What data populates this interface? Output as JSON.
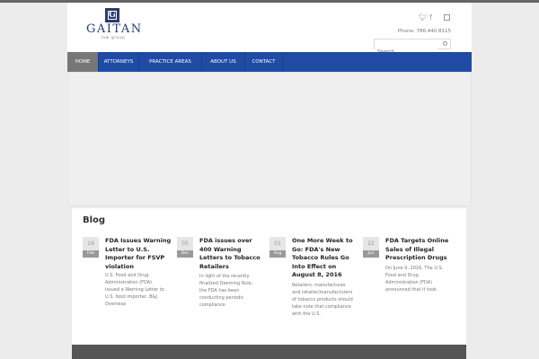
{
  "brand": {
    "name": "GAITAN",
    "tagline": "law group",
    "logo_letter": "G",
    "color": "#2a3a6e"
  },
  "header": {
    "phone": "Phone: 786.440.8115",
    "search_placeholder": "Search",
    "social": [
      "twitter-icon",
      "facebook-icon",
      "linkedin-icon"
    ]
  },
  "nav": {
    "accent": "#1f4ba5",
    "items": [
      {
        "label": "HOME",
        "active": true
      },
      {
        "label": "ATTORNEYS"
      },
      {
        "label": "PRACTICE AREAS"
      },
      {
        "label": "ABOUT US"
      },
      {
        "label": "CONTACT"
      }
    ]
  },
  "blog": {
    "title": "Blog",
    "posts": [
      {
        "day": "19",
        "month": "Feb",
        "title": "FDA Issues Warning Letter to U.S. Importer for FSVP violation",
        "excerpt": "U.S. Food and Drug Administration (FDA) issued a Warning Letter to U.S. food importer, B&J Overseas"
      },
      {
        "day": "05",
        "month": "Dec",
        "title": "FDA issues over 400 Warning Letters to Tobacco Retailers",
        "excerpt": "In light of the recently finalized Deeming Rule, the FDA has been conducting periodic compliance"
      },
      {
        "day": "01",
        "month": "Aug",
        "title": "One More Week to Go: FDA's New Tobacco Rules Go Into Effect on August 8, 2016",
        "excerpt": "Retailers, manufactures and retailer/manufacturers of tobacco products should take note that compliance with the U.S."
      },
      {
        "day": "22",
        "month": "Jun",
        "title": "FDA Targets Online Sales of Illegal Prescription Drugs",
        "excerpt": "On June 9, 2016, The U.S. Food and Drug Administration (FDA) announced that it took"
      }
    ]
  }
}
